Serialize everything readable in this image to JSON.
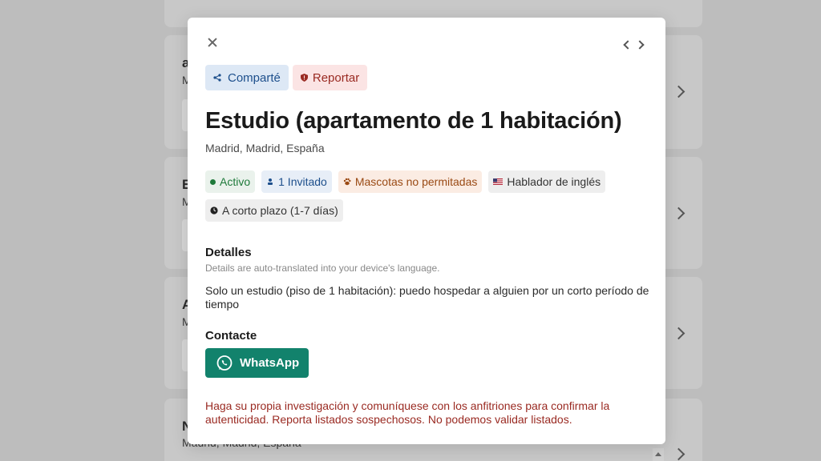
{
  "background": {
    "cards": [
      {
        "title": "a",
        "subtitle": "M"
      },
      {
        "title": "E",
        "subtitle": "M"
      },
      {
        "title": "A",
        "subtitle": "M"
      },
      {
        "title": "N",
        "subtitle": "Madrid, Madrid, España"
      }
    ]
  },
  "modal": {
    "share_label": "Comparté",
    "report_label": "Reportar",
    "title": "Estudio (apartamento de 1 habitación)",
    "location": "Madrid, Madrid, España",
    "tags": {
      "status": "Activo",
      "guests": "1 Invitado",
      "pets": "Mascotas no permitadas",
      "language": "Hablador de inglés",
      "term": "A corto plazo (1-7 días)"
    },
    "details_heading": "Detalles",
    "details_hint": "Details are auto-translated into your device's language.",
    "details_text": "Solo un estudio (piso de 1 habitación): puedo hospedar a alguien por un corto período de tiempo",
    "contact_heading": "Contacte",
    "whatsapp_label": "WhatsApp",
    "disclaimer": "Haga su propia investigación y comuníquese con los anfitriones para confirmar la autenticidad. Reporta listados sospechosos. No podemos validar listados."
  },
  "colors": {
    "whatsapp": "#12826c",
    "active": "#1e7a3a",
    "warning": "#9a2a22",
    "share": "#1d4f8c"
  }
}
